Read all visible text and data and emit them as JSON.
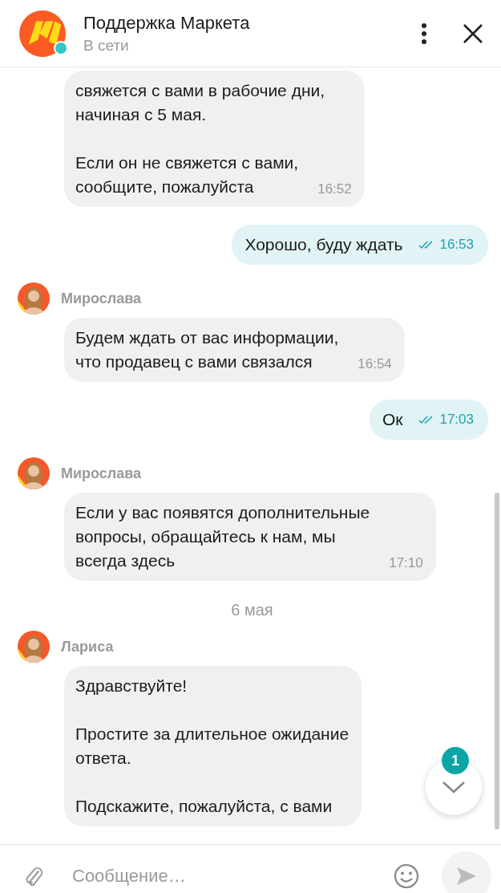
{
  "header": {
    "title": "Поддержка Маркета",
    "status": "В сети",
    "online": true
  },
  "messages": [
    {
      "kind": "incoming",
      "paragraphs": [
        "свяжется с вами в рабочие дни,\nначиная с 5 мая.",
        "Если он не свяжется с вами,\nсообщите, пожалуйста"
      ],
      "time": "16:52"
    },
    {
      "kind": "outgoing",
      "text": "Хорошо, буду ждать",
      "time": "16:53",
      "read": true
    },
    {
      "kind": "incoming",
      "sender": "Мирослава",
      "paragraphs": [
        "Будем ждать от вас информации,\nчто продавец с вами связался"
      ],
      "time": "16:54"
    },
    {
      "kind": "outgoing",
      "text": "Ок",
      "time": "17:03",
      "read": true
    },
    {
      "kind": "incoming",
      "sender": "Мирослава",
      "paragraphs": [
        "Если у вас появятся дополнительные\nвопросы, обращайтесь к нам, мы\nвсегда здесь"
      ],
      "time": "17:10"
    },
    {
      "kind": "date",
      "text": "6 мая"
    },
    {
      "kind": "incoming",
      "sender": "Лариса",
      "paragraphs": [
        "Здравствуйте!",
        "Простите за длительное ожидание\nответа.",
        "Подскажите, пожалуйста, с вами"
      ]
    }
  ],
  "scroll_button": {
    "badge": "1"
  },
  "composer": {
    "placeholder": "Сообщение…",
    "send_disabled": true
  }
}
